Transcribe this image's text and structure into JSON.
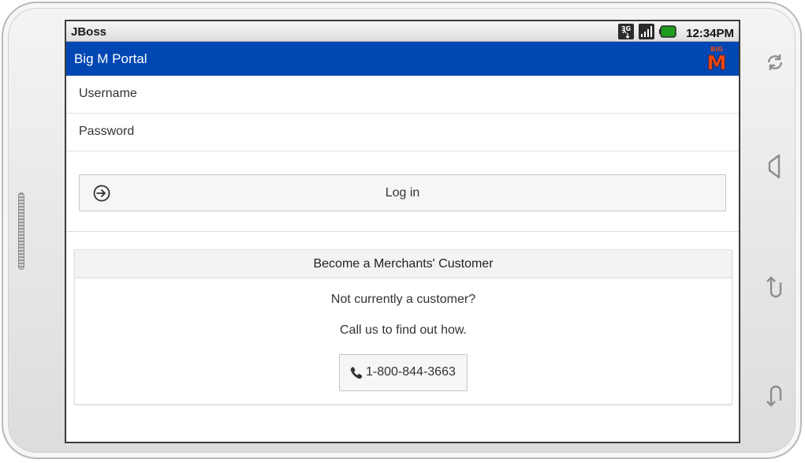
{
  "statusbar": {
    "title": "JBoss",
    "time": "12:34PM"
  },
  "appbar": {
    "title": "Big M Portal",
    "logo_text_top": "BIG",
    "logo_text_main": "M"
  },
  "login_form": {
    "username_placeholder": "Username",
    "password_placeholder": "Password",
    "login_label": "Log in"
  },
  "customer_card": {
    "title": "Become a Merchants' Customer",
    "line1": "Not currently a customer?",
    "line2": "Call us to find out how.",
    "phone_label": "1-800-844-3663"
  },
  "colors": {
    "appbar": "#0047b3",
    "logo": "#f04a14"
  }
}
